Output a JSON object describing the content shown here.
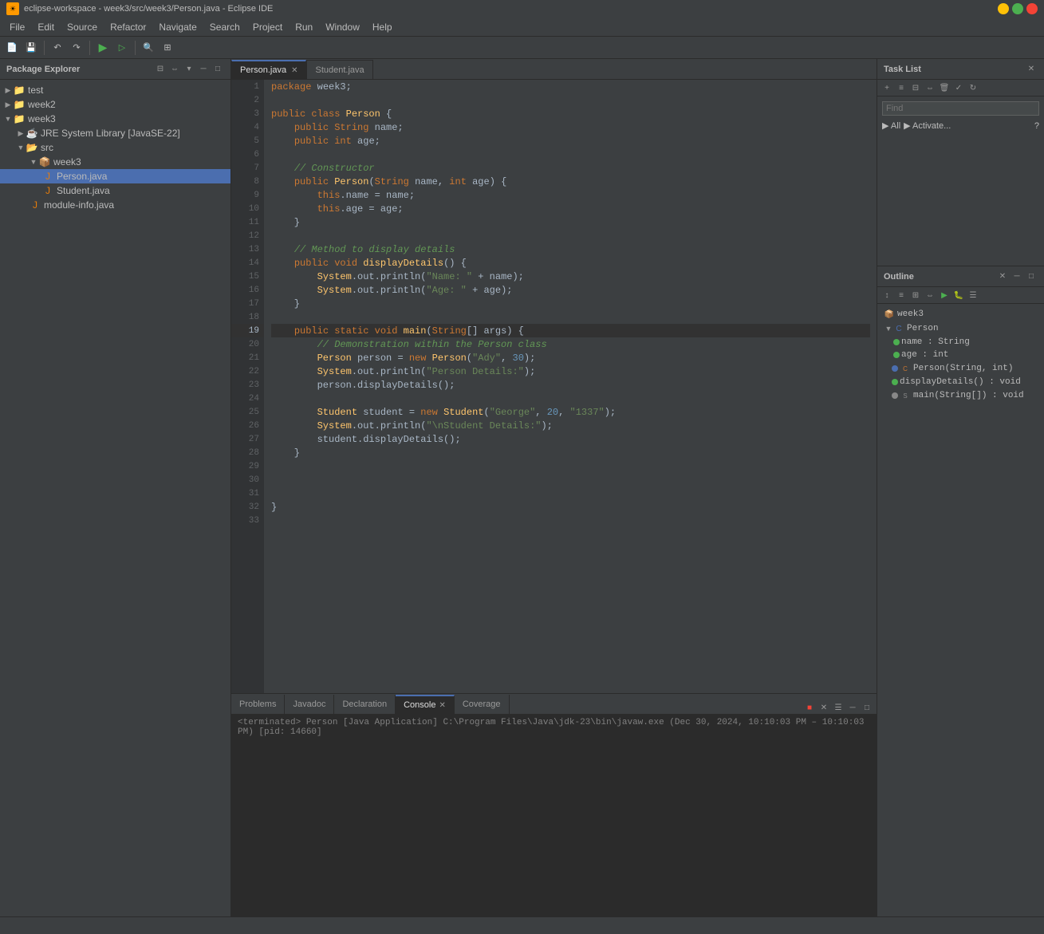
{
  "window": {
    "title": "eclipse-workspace - week3/src/week3/Person.java - Eclipse IDE",
    "icon": "☀"
  },
  "menu": {
    "items": [
      "File",
      "Edit",
      "Source",
      "Refactor",
      "Navigate",
      "Search",
      "Project",
      "Run",
      "Window",
      "Help"
    ]
  },
  "package_explorer": {
    "title": "Package Explorer",
    "items": [
      {
        "label": "test",
        "level": 0,
        "type": "project",
        "expanded": false
      },
      {
        "label": "week2",
        "level": 0,
        "type": "project",
        "expanded": false
      },
      {
        "label": "week3",
        "level": 0,
        "type": "project",
        "expanded": true
      },
      {
        "label": "JRE System Library [JavaSE-22]",
        "level": 1,
        "type": "library",
        "expanded": false
      },
      {
        "label": "src",
        "level": 1,
        "type": "folder",
        "expanded": true
      },
      {
        "label": "week3",
        "level": 2,
        "type": "package",
        "expanded": true
      },
      {
        "label": "Person.java",
        "level": 3,
        "type": "java",
        "selected": true
      },
      {
        "label": "Student.java",
        "level": 3,
        "type": "java"
      },
      {
        "label": "module-info.java",
        "level": 2,
        "type": "java"
      }
    ]
  },
  "editor": {
    "tabs": [
      {
        "label": "Person.java",
        "active": true,
        "closeable": true
      },
      {
        "label": "Student.java",
        "active": false,
        "closeable": false
      }
    ],
    "lines": [
      {
        "num": 1,
        "content": "package week3;"
      },
      {
        "num": 2,
        "content": ""
      },
      {
        "num": 3,
        "content": "public class Person {"
      },
      {
        "num": 4,
        "content": "    public String name;"
      },
      {
        "num": 5,
        "content": "    public int age;"
      },
      {
        "num": 6,
        "content": ""
      },
      {
        "num": 7,
        "content": "    // Constructor"
      },
      {
        "num": 8,
        "content": "    public Person(String name, int age) {"
      },
      {
        "num": 9,
        "content": "        this.name = name;"
      },
      {
        "num": 10,
        "content": "        this.age = age;"
      },
      {
        "num": 11,
        "content": "    }"
      },
      {
        "num": 12,
        "content": ""
      },
      {
        "num": 13,
        "content": "    // Method to display details"
      },
      {
        "num": 14,
        "content": "    public void displayDetails() {"
      },
      {
        "num": 15,
        "content": "        System.out.println(\"Name: \" + name);"
      },
      {
        "num": 16,
        "content": "        System.out.println(\"Age: \" + age);"
      },
      {
        "num": 17,
        "content": "    }"
      },
      {
        "num": 18,
        "content": ""
      },
      {
        "num": 19,
        "content": "    public static void main(String[] args) {",
        "active": true
      },
      {
        "num": 20,
        "content": "        // Demonstration within the Person class"
      },
      {
        "num": 21,
        "content": "        Person person = new Person(\"Ady\", 30);"
      },
      {
        "num": 22,
        "content": "        System.out.println(\"Person Details:\");"
      },
      {
        "num": 23,
        "content": "        person.displayDetails();"
      },
      {
        "num": 24,
        "content": ""
      },
      {
        "num": 25,
        "content": "        Student student = new Student(\"George\", 20, \"1337\");"
      },
      {
        "num": 26,
        "content": "        System.out.println(\"\\nStudent Details:\");"
      },
      {
        "num": 27,
        "content": "        student.displayDetails();"
      },
      {
        "num": 28,
        "content": "    }"
      },
      {
        "num": 29,
        "content": ""
      },
      {
        "num": 30,
        "content": ""
      },
      {
        "num": 31,
        "content": ""
      },
      {
        "num": 32,
        "content": "}"
      },
      {
        "num": 33,
        "content": ""
      }
    ]
  },
  "task_list": {
    "title": "Task List",
    "find_placeholder": "Find",
    "options": [
      "All",
      "Activate..."
    ]
  },
  "outline": {
    "title": "Outline",
    "items": [
      {
        "label": "week3",
        "level": 0,
        "type": "package",
        "expanded": true
      },
      {
        "label": "Person",
        "level": 1,
        "type": "class",
        "expanded": true
      },
      {
        "label": "name : String",
        "level": 2,
        "type": "field"
      },
      {
        "label": "age : int",
        "level": 2,
        "type": "field"
      },
      {
        "label": "Person(String, int)",
        "level": 2,
        "type": "constructor"
      },
      {
        "label": "displayDetails() : void",
        "level": 2,
        "type": "method"
      },
      {
        "label": "main(String[]) : void",
        "level": 2,
        "type": "static-method"
      }
    ]
  },
  "bottom": {
    "tabs": [
      "Problems",
      "Javadoc",
      "Declaration",
      "Console",
      "Coverage"
    ],
    "active_tab": "Console",
    "console_text": "<terminated> Person [Java Application] C:\\Program Files\\Java\\jdk-23\\bin\\javaw.exe  (Dec 30, 2024, 10:10:03 PM – 10:10:03 PM) [pid: 14660]"
  },
  "status_bar": {
    "text": ""
  }
}
